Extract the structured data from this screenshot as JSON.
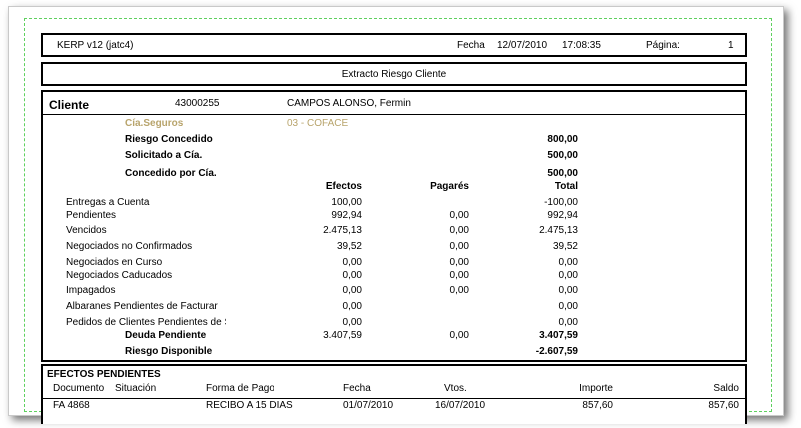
{
  "header": {
    "app": "KERP v12 (jatc4)",
    "fecha_label": "Fecha",
    "fecha": "12/07/2010",
    "hora": "17:08:35",
    "pagina_label": "Página:",
    "pagina": "1"
  },
  "report_title": "Extracto Riesgo Cliente",
  "cliente": {
    "label": "Cliente",
    "code": "43000255",
    "name": "CAMPOS ALONSO, Fermin",
    "cia_label": "Cía.Seguros",
    "cia_value": "03 - COFACE",
    "riesgo_concedido_label": "Riesgo Concedido",
    "riesgo_concedido": "800,00",
    "solicitado_label": "Solicitado a Cía.",
    "solicitado": "500,00",
    "concedido_label": "Concedido por Cía.",
    "concedido": "500,00"
  },
  "columns": {
    "efectos": "Efectos",
    "pagares": "Pagarés",
    "total": "Total"
  },
  "rows": [
    {
      "label": "Entregas a Cuenta",
      "efectos": "100,00",
      "pagares": "",
      "total": "-100,00"
    },
    {
      "label": "Pendientes",
      "efectos": "992,94",
      "pagares": "0,00",
      "total": "992,94"
    },
    {
      "label": "Vencidos",
      "efectos": "2.475,13",
      "pagares": "0,00",
      "total": "2.475,13"
    },
    {
      "label": "Negociados no Confirmados",
      "efectos": "39,52",
      "pagares": "0,00",
      "total": "39,52"
    },
    {
      "label": "Negociados en Curso",
      "efectos": "0,00",
      "pagares": "0,00",
      "total": "0,00"
    },
    {
      "label": "Negociados Caducados",
      "efectos": "0,00",
      "pagares": "0,00",
      "total": "0,00"
    },
    {
      "label": "Impagados",
      "efectos": "0,00",
      "pagares": "0,00",
      "total": "0,00"
    },
    {
      "label": "Albaranes Pendientes de Facturar",
      "efectos": "0,00",
      "pagares": "",
      "total": "0,00"
    },
    {
      "label": "Pedidos de Clientes Pendientes de Ser",
      "efectos": "0,00",
      "pagares": "",
      "total": "0,00"
    }
  ],
  "deuda": {
    "label": "Deuda Pendiente",
    "efectos": "3.407,59",
    "pagares": "0,00",
    "total": "3.407,59"
  },
  "disponible": {
    "label": "Riesgo Disponible",
    "total": "-2.607,59"
  },
  "efectos_pendientes": {
    "title": "EFECTOS PENDIENTES",
    "headers": {
      "documento": "Documento",
      "situacion": "Situación",
      "forma": "Forma de Pago",
      "fecha": "Fecha",
      "vtos": "Vtos.",
      "importe": "Importe",
      "saldo": "Saldo"
    },
    "row": {
      "documento": "FA 4868",
      "forma": "RECIBO A 15 DIAS",
      "fecha": "01/07/2010",
      "vto": "16/07/2010",
      "importe": "857,60",
      "saldo": "857,60"
    }
  }
}
